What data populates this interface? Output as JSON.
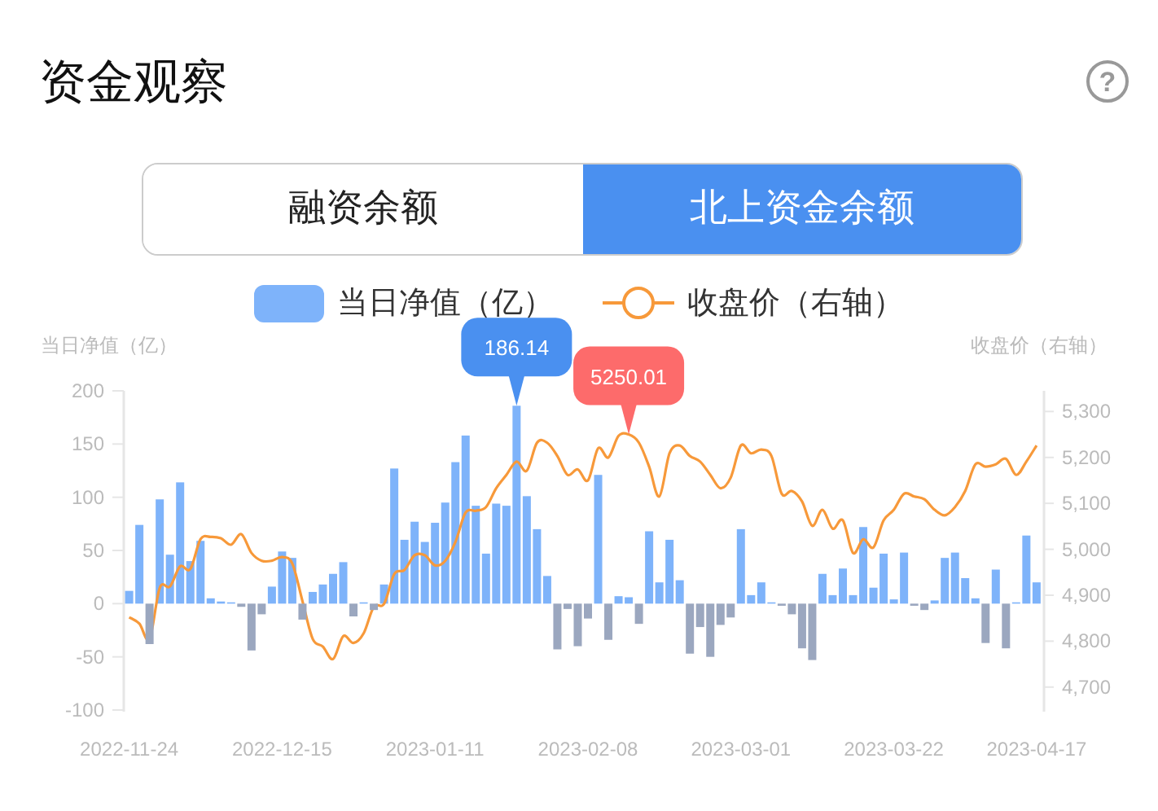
{
  "title": "资金观察",
  "help": {
    "icon": "?"
  },
  "tabs": [
    {
      "label": "融资余额",
      "selected": false
    },
    {
      "label": "北上资金余额",
      "selected": true
    }
  ],
  "chart_data": {
    "type": "bar",
    "legend": "top",
    "ylabel": "当日净值（亿）",
    "y2label": "收盘价（右轴）",
    "categories": [
      "2022-11-24",
      null,
      null,
      null,
      null,
      null,
      null,
      null,
      null,
      null,
      null,
      null,
      null,
      null,
      null,
      "2022-12-15",
      null,
      null,
      null,
      null,
      null,
      null,
      null,
      null,
      null,
      null,
      null,
      null,
      null,
      null,
      "2023-01-11",
      null,
      null,
      null,
      null,
      null,
      null,
      null,
      null,
      null,
      null,
      null,
      null,
      null,
      null,
      "2023-02-08",
      null,
      null,
      null,
      null,
      null,
      null,
      null,
      null,
      null,
      null,
      null,
      null,
      null,
      null,
      "2023-03-01",
      null,
      null,
      null,
      null,
      null,
      null,
      null,
      null,
      null,
      null,
      null,
      null,
      null,
      null,
      "2023-03-22",
      null,
      null,
      null,
      null,
      null,
      null,
      null,
      null,
      null,
      null,
      null,
      null,
      null,
      "2023-04-17"
    ],
    "ylim": [
      -100,
      200
    ],
    "yticks": [
      -100,
      -50,
      0,
      50,
      100,
      150,
      200
    ],
    "y2lim": [
      4650,
      5345
    ],
    "y2ticks": [
      {
        "value": 4700,
        "label": "4,700"
      },
      {
        "value": 4800,
        "label": "4,800"
      },
      {
        "value": 4900,
        "label": "4,900"
      },
      {
        "value": 5000,
        "label": "5,000"
      },
      {
        "value": 5100,
        "label": "5,100"
      },
      {
        "value": 5200,
        "label": "5,200"
      },
      {
        "value": 5300,
        "label": "5,300"
      }
    ],
    "series": [
      {
        "name": "当日净值（亿）",
        "type": "bar",
        "color": "#7eb3fa",
        "values": [
          12,
          74,
          null,
          98,
          46,
          114,
          40,
          59,
          5,
          2,
          1,
          null,
          null,
          null,
          16,
          49,
          43,
          null,
          11,
          18,
          28,
          39,
          null,
          1,
          null,
          18,
          127,
          60,
          77,
          58,
          76,
          95,
          133,
          158,
          92,
          47,
          94,
          92,
          186,
          101,
          70,
          26,
          null,
          null,
          null,
          null,
          121,
          null,
          7,
          6,
          null,
          68,
          20,
          60,
          22,
          null,
          null,
          null,
          null,
          null,
          70,
          8,
          20,
          1,
          null,
          null,
          null,
          null,
          28,
          8,
          33,
          8,
          72,
          15,
          47,
          4,
          48,
          null,
          null,
          3,
          43,
          48,
          24,
          5,
          null,
          32,
          null,
          1,
          64,
          20
        ]
      },
      {
        "name": "收盘价（右轴）",
        "type": "line",
        "axis": "y2",
        "color": "#f7993a",
        "values": [
          4852,
          4838,
          4805,
          4916,
          4919,
          4963,
          4957,
          5022,
          5027,
          5024,
          5010,
          5033,
          4992,
          4975,
          4975,
          4983,
          4969,
          4887,
          4805,
          4788,
          4761,
          4811,
          4796,
          4817,
          4875,
          4881,
          4946,
          4955,
          4987,
          4987,
          4965,
          4975,
          5016,
          5080,
          5084,
          5092,
          5133,
          5162,
          5191,
          5171,
          5232,
          5232,
          5203,
          5162,
          5174,
          5150,
          5220,
          5200,
          5247,
          5250,
          5232,
          5180,
          5115,
          5209,
          5226,
          5203,
          5191,
          5162,
          5133,
          5156,
          5226,
          5209,
          5217,
          5203,
          5121,
          5127,
          5104,
          5051,
          5086,
          5045,
          5063,
          4992,
          5022,
          5004,
          5063,
          5086,
          5121,
          5115,
          5109,
          5086,
          5074,
          5092,
          5127,
          5185,
          5180,
          5185,
          5197,
          5162,
          5191,
          5226
        ]
      },
      {
        "type": "bar",
        "color": "#9ba7bf",
        "values": [
          null,
          null,
          -38,
          null,
          null,
          null,
          null,
          null,
          null,
          null,
          null,
          -3,
          -44,
          -10,
          null,
          null,
          null,
          -15,
          null,
          null,
          null,
          null,
          -12,
          null,
          -6,
          null,
          null,
          null,
          null,
          null,
          null,
          null,
          null,
          null,
          null,
          null,
          null,
          null,
          null,
          null,
          null,
          null,
          -43,
          -5,
          -40,
          -14,
          null,
          -34,
          null,
          null,
          -19,
          null,
          null,
          null,
          null,
          -47,
          -22,
          -50,
          -20,
          -13,
          null,
          null,
          null,
          null,
          -2,
          -10,
          -42,
          -53,
          null,
          null,
          null,
          null,
          null,
          null,
          null,
          null,
          null,
          -2,
          -6,
          null,
          null,
          null,
          null,
          null,
          -37,
          null,
          -42,
          null,
          null,
          null
        ]
      }
    ],
    "annotations": [
      {
        "text": "186.14"
      },
      {
        "text": "5250.01"
      }
    ]
  }
}
